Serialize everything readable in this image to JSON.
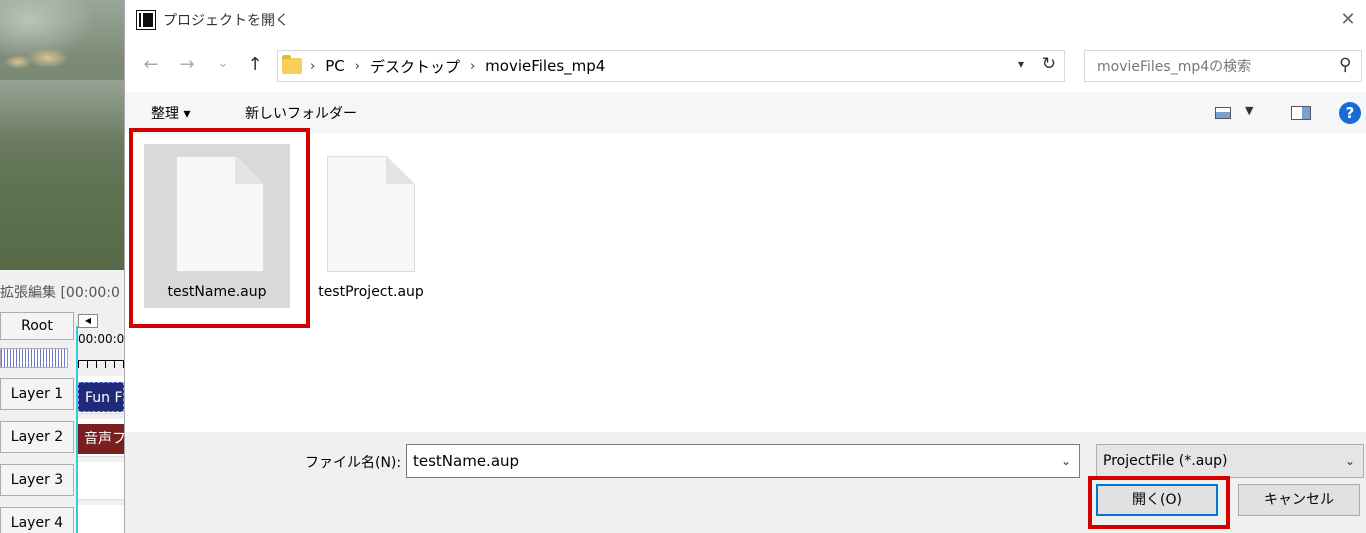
{
  "background_app": {
    "extended_edit_label": "拡張編集 [00:00:0",
    "root_label": "Root",
    "ruler_time": "00:00:0",
    "layers": [
      "Layer 1",
      "Layer 2",
      "Layer 3",
      "Layer 4"
    ],
    "clips": {
      "layer1": "Fun F",
      "layer2": "音声フ"
    }
  },
  "dialog": {
    "title": "プロジェクトを開く",
    "close_glyph": "✕",
    "nav": {
      "back": "←",
      "forward": "→",
      "recent": "⌄",
      "up": "↑"
    },
    "breadcrumb": [
      "PC",
      "デスクトップ",
      "movieFiles_mp4"
    ],
    "breadcrumb_sep": "›",
    "search_placeholder": "movieFiles_mp4の検索",
    "toolbar": {
      "organize": "整理 ▾",
      "new_folder": "新しいフォルダー",
      "help": "?"
    },
    "files": [
      {
        "name": "testName.aup",
        "selected": true
      },
      {
        "name": "testProject.aup",
        "selected": false
      }
    ],
    "filename_label": "ファイル名(N):",
    "filename_value": "testName.aup",
    "filter_value": "ProjectFile (*.aup)",
    "open_button": "開く(O)",
    "cancel_button": "キャンセル"
  },
  "colors": {
    "highlight": "#d40000",
    "selection": "#d9d9d9",
    "accent": "#0078d7"
  }
}
